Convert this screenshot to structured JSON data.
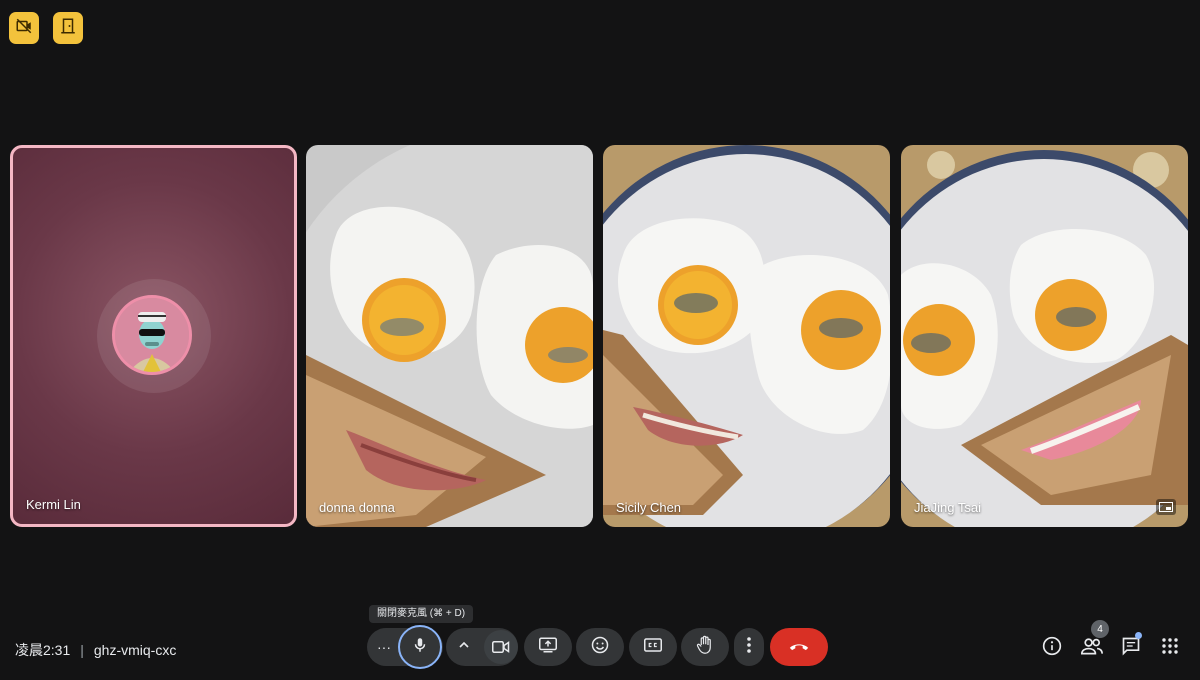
{
  "top_badges": [
    {
      "icon": "no-camera-icon"
    },
    {
      "icon": "door-icon"
    }
  ],
  "participants": [
    {
      "name": "Kermi Lin"
    },
    {
      "name": "donna donna"
    },
    {
      "name": "Sicily Chen"
    },
    {
      "name": "JiaJing Tsai"
    }
  ],
  "meeting": {
    "time": "凌晨2:31",
    "separator": "|",
    "code": "ghz-vmiq-cxc"
  },
  "tooltip": "關閉麥克風 (⌘ + D)",
  "controls": {
    "more_dots": "···",
    "people_count": "4"
  },
  "colors": {
    "background": "#131314",
    "badge": "#f3c23c",
    "end_call": "#d93025",
    "mic_ring": "#8ab4f8",
    "self_tile": "#6a3848"
  }
}
